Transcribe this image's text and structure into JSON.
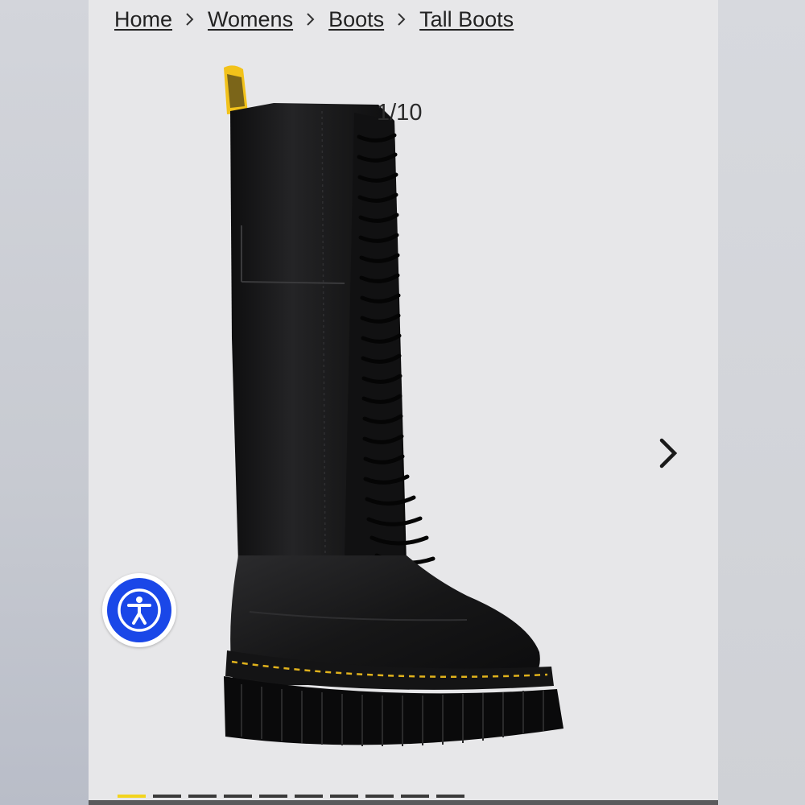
{
  "breadcrumb": {
    "items": [
      {
        "label": "Home"
      },
      {
        "label": "Womens"
      },
      {
        "label": "Boots"
      },
      {
        "label": "Tall Boots"
      }
    ]
  },
  "gallery": {
    "counter": "1/10",
    "total_images": 10,
    "active_index": 0
  },
  "icons": {
    "separator": "chevron-right-icon",
    "next": "chevron-right-icon",
    "accessibility": "accessibility-person-icon"
  },
  "colors": {
    "page_bg": "#e7e7e9",
    "accent_yellow": "#f2d41e",
    "accessibility_blue": "#1a47e8",
    "text": "#222222"
  }
}
